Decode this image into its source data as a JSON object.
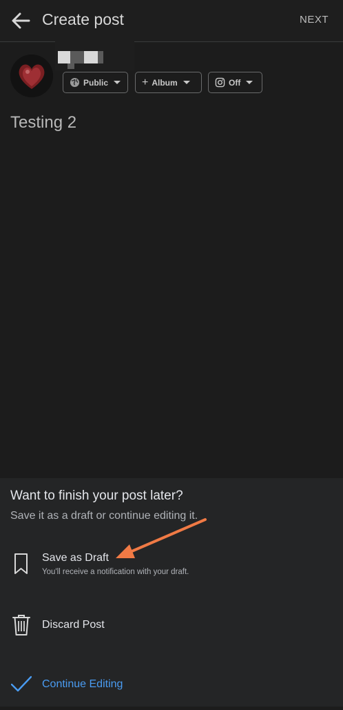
{
  "header": {
    "title": "Create post",
    "next_label": "NEXT"
  },
  "audience": {
    "privacy_label": "Public",
    "album_label": "Album",
    "instagram_label": "Off"
  },
  "composer": {
    "text": "Testing 2"
  },
  "sheet": {
    "title": "Want to finish your post later?",
    "subtitle": "Save it as a draft or continue editing it.",
    "options": [
      {
        "label": "Save as Draft",
        "sublabel": "You'll receive a notification with your draft.",
        "icon": "bookmark-icon"
      },
      {
        "label": "Discard Post",
        "icon": "trash-icon"
      },
      {
        "label": "Continue Editing",
        "icon": "check-icon"
      }
    ]
  },
  "colors": {
    "background": "#1c1c1c",
    "sheet": "#242526",
    "accent_blue": "#4a9cf2",
    "annotation_arrow": "#f07a45"
  }
}
